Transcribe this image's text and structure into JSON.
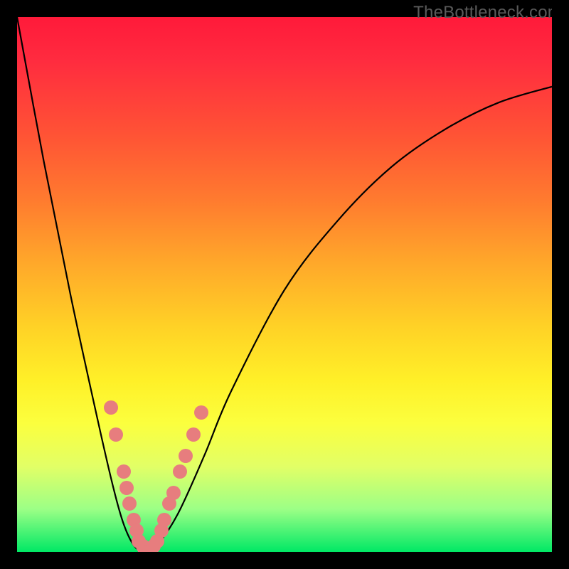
{
  "watermark": "TheBottleneck.com",
  "colors": {
    "dot": "#e77d7e",
    "curve": "#000000",
    "gradient_top": "#ff1a3a",
    "gradient_bottom": "#00e865"
  },
  "chart_data": {
    "type": "line",
    "title": "",
    "xlabel": "",
    "ylabel": "",
    "xlim": [
      0,
      100
    ],
    "ylim": [
      0,
      100
    ],
    "grid": false,
    "legend": false,
    "series": [
      {
        "name": "bottleneck-curve",
        "x": [
          0,
          5,
          10,
          15,
          18,
          20,
          22,
          24,
          26,
          30,
          35,
          40,
          50,
          60,
          70,
          80,
          90,
          100
        ],
        "y": [
          100,
          73,
          48,
          25,
          12,
          5,
          1,
          0,
          1,
          7,
          18,
          30,
          49,
          62,
          72,
          79,
          84,
          87
        ]
      }
    ],
    "markers": [
      {
        "x": 17.5,
        "y": 27
      },
      {
        "x": 18.5,
        "y": 22
      },
      {
        "x": 20.0,
        "y": 15
      },
      {
        "x": 20.5,
        "y": 12
      },
      {
        "x": 21.0,
        "y": 9
      },
      {
        "x": 21.8,
        "y": 6
      },
      {
        "x": 22.3,
        "y": 4
      },
      {
        "x": 22.8,
        "y": 2
      },
      {
        "x": 23.5,
        "y": 1
      },
      {
        "x": 24.0,
        "y": 0
      },
      {
        "x": 24.7,
        "y": 0
      },
      {
        "x": 25.5,
        "y": 1
      },
      {
        "x": 26.2,
        "y": 2
      },
      {
        "x": 27.0,
        "y": 4
      },
      {
        "x": 27.5,
        "y": 6
      },
      {
        "x": 28.5,
        "y": 9
      },
      {
        "x": 29.2,
        "y": 11
      },
      {
        "x": 30.5,
        "y": 15
      },
      {
        "x": 31.5,
        "y": 18
      },
      {
        "x": 33.0,
        "y": 22
      },
      {
        "x": 34.5,
        "y": 26
      }
    ]
  }
}
